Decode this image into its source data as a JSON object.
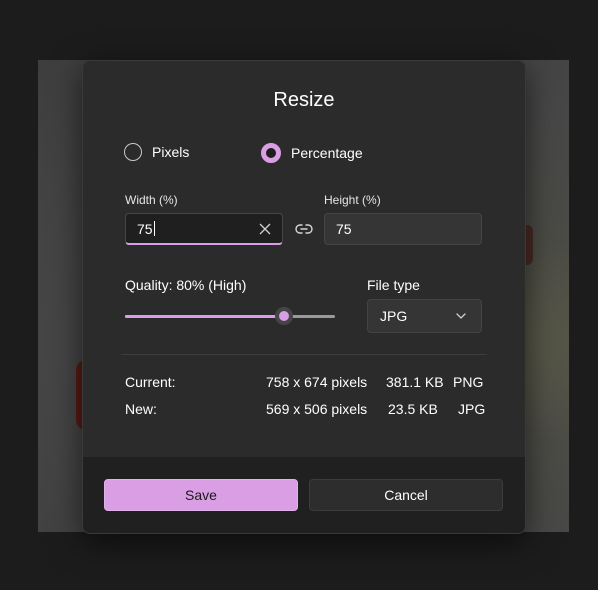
{
  "dialog": {
    "title": "Resize"
  },
  "mode": {
    "options": [
      {
        "label": "Pixels",
        "checked": false
      },
      {
        "label": "Percentage",
        "checked": true
      }
    ]
  },
  "width": {
    "label": "Width  (%)",
    "value": "75"
  },
  "height": {
    "label": "Height  (%)",
    "value": "75"
  },
  "quality": {
    "label": "Quality: 80% (High)",
    "value_percent": 80
  },
  "file_type": {
    "label": "File type",
    "selected": "JPG"
  },
  "current": {
    "label": "Current:",
    "dimensions": "758 x 674 pixels",
    "size": "381.1 KB",
    "format": "PNG"
  },
  "new": {
    "label": "New:",
    "dimensions": "569 x 506 pixels",
    "size": "23.5 KB",
    "format": "JPG"
  },
  "buttons": {
    "save": "Save",
    "cancel": "Cancel"
  },
  "colors": {
    "accent": "#d99ee3",
    "dialog_bg": "#2b2b2b",
    "footer_bg": "#202020"
  },
  "icons": {
    "clear": "close-icon",
    "link": "link-icon",
    "dropdown": "chevron-down-icon"
  }
}
